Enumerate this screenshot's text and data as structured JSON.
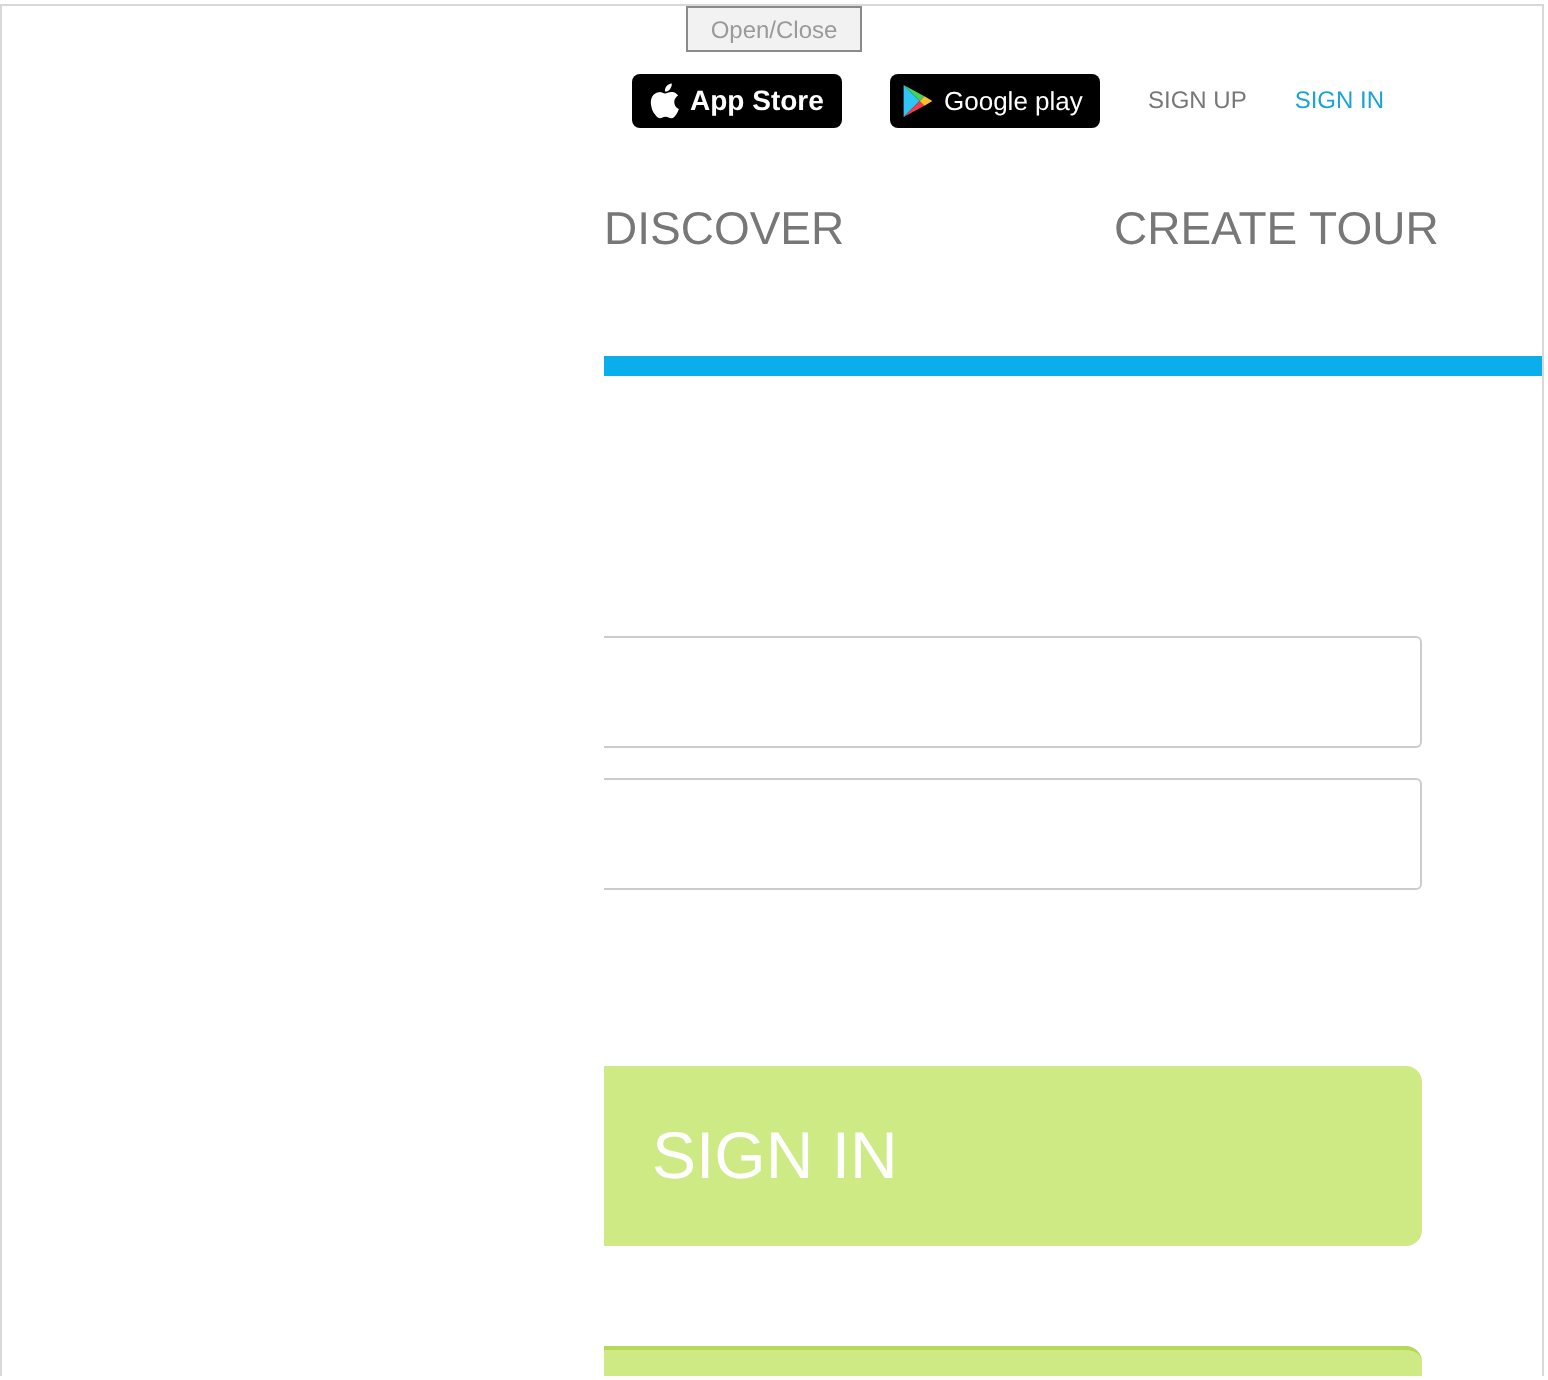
{
  "toggle_button": {
    "label": "Open/Close"
  },
  "store_badges": [
    {
      "kind": "apple",
      "label": "App Store"
    },
    {
      "kind": "google",
      "label": "Google play"
    }
  ],
  "auth_links": [
    {
      "label": "SIGN UP",
      "selected": false
    },
    {
      "label": "SIGN IN",
      "selected": true
    }
  ],
  "nav": [
    {
      "label": "DISCOVER"
    },
    {
      "label": "CREATE TOUR"
    }
  ],
  "form": {
    "submit": {
      "label": "SIGN IN"
    }
  }
}
